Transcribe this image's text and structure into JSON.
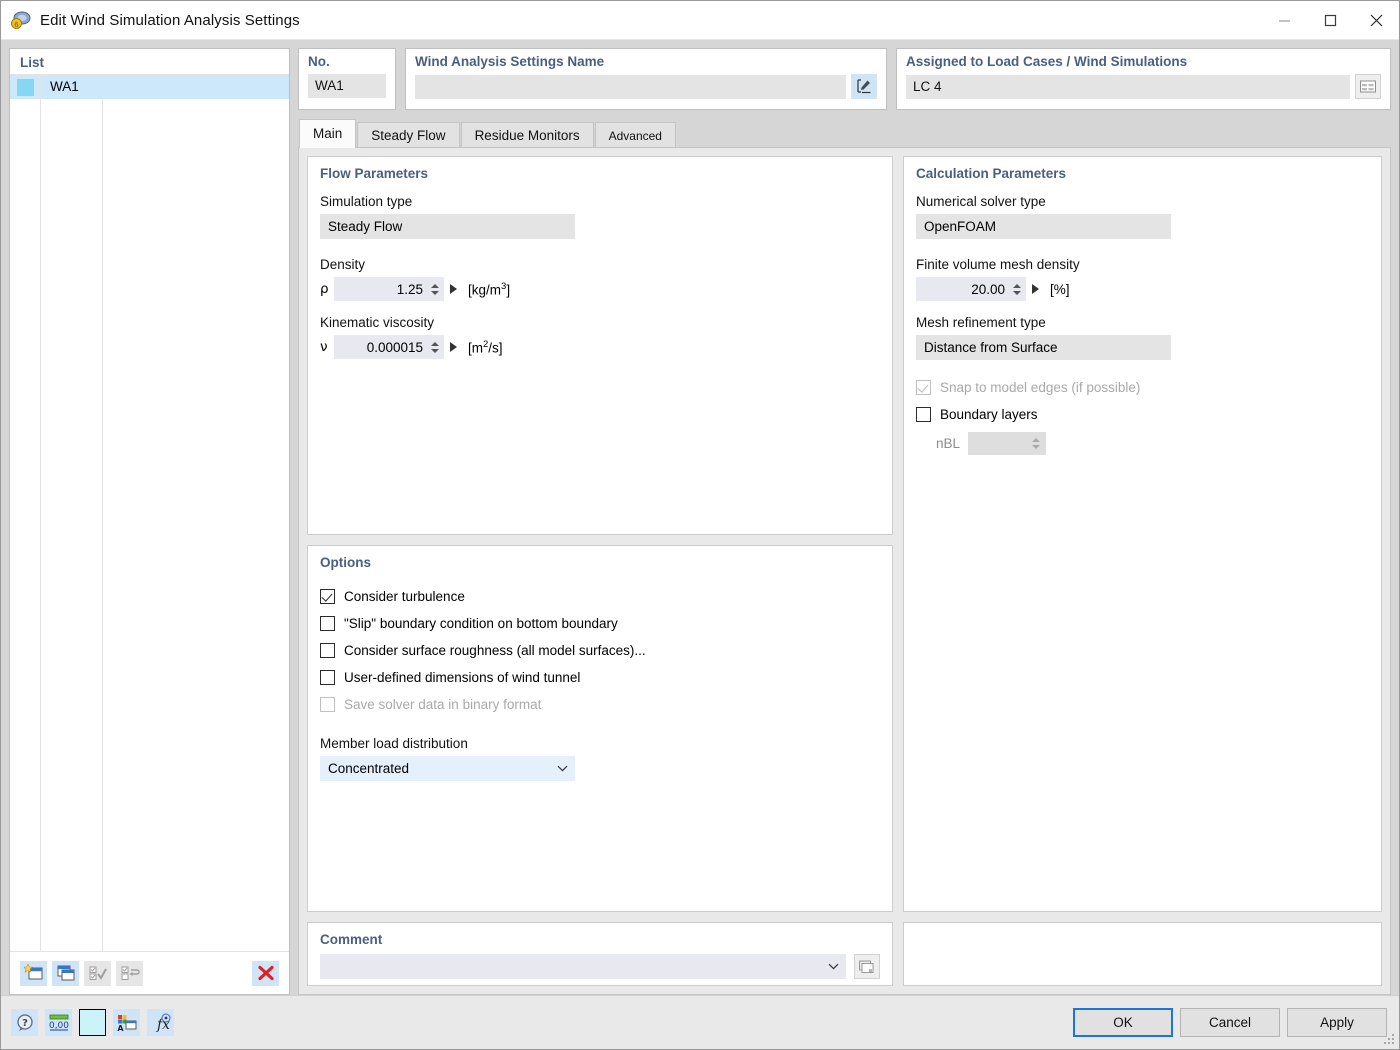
{
  "window": {
    "title": "Edit Wind Simulation Analysis Settings",
    "icon": "wind-simulation-icon",
    "minimize_label": "Minimize",
    "maximize_label": "Maximize",
    "close_label": "Close"
  },
  "list_panel": {
    "caption": "List",
    "rows": [
      {
        "color": "#85d7f2",
        "label": "WA1"
      }
    ],
    "toolbar": [
      {
        "name": "new-settings-button",
        "title": "New",
        "enabled": true
      },
      {
        "name": "copy-settings-button",
        "title": "Copy",
        "enabled": true
      },
      {
        "name": "select-all-button",
        "title": "Select All",
        "enabled": false
      },
      {
        "name": "invert-selection-button",
        "title": "Invert Selection",
        "enabled": false
      },
      {
        "name": "delete-button",
        "title": "Delete",
        "enabled": true
      }
    ]
  },
  "header": {
    "no_label": "No.",
    "no_value": "WA1",
    "name_label": "Wind Analysis Settings Name",
    "name_value": "",
    "name_edit_button": "rename-icon",
    "assigned_label": "Assigned to Load Cases / Wind Simulations",
    "assigned_value": "LC 4",
    "assigned_button": "load-cases-icon"
  },
  "tabs": [
    {
      "label": "Main",
      "active": true
    },
    {
      "label": "Steady Flow",
      "active": false
    },
    {
      "label": "Residue Monitors",
      "active": false
    },
    {
      "label": "Advanced",
      "active": false,
      "small": true
    }
  ],
  "flow_parameters": {
    "title": "Flow Parameters",
    "simulation_type_label": "Simulation type",
    "simulation_type_value": "Steady Flow",
    "density_label": "Density",
    "density_symbol": "ρ",
    "density_value": "1.25",
    "density_unit_prefix": "[kg/m",
    "density_unit_sup": "3",
    "density_unit_suffix": "]",
    "viscosity_label": "Kinematic viscosity",
    "viscosity_symbol": "ν",
    "viscosity_value": "0.000015",
    "viscosity_unit_prefix": "[m",
    "viscosity_unit_sup": "2",
    "viscosity_unit_suffix": "/s]"
  },
  "options": {
    "title": "Options",
    "checkboxes": [
      {
        "label": "Consider turbulence",
        "checked": true,
        "enabled": true
      },
      {
        "label": "\"Slip\" boundary condition on bottom boundary",
        "checked": false,
        "enabled": true
      },
      {
        "label": "Consider surface roughness (all model surfaces)...",
        "checked": false,
        "enabled": true
      },
      {
        "label": "User-defined dimensions of wind tunnel",
        "checked": false,
        "enabled": true
      },
      {
        "label": "Save solver data in binary format",
        "checked": false,
        "enabled": false
      }
    ],
    "member_load_label": "Member load distribution",
    "member_load_value": "Concentrated"
  },
  "calculation_parameters": {
    "title": "Calculation Parameters",
    "solver_label": "Numerical solver type",
    "solver_value": "OpenFOAM",
    "mesh_density_label": "Finite volume mesh density",
    "mesh_density_value": "20.00",
    "mesh_density_unit": "[%]",
    "refinement_label": "Mesh refinement type",
    "refinement_value": "Distance from Surface",
    "checkboxes": [
      {
        "label": "Snap to model edges (if possible)",
        "checked": true,
        "enabled": false
      },
      {
        "label": "Boundary layers",
        "checked": false,
        "enabled": true
      }
    ],
    "nbl_label": "nBL",
    "nbl_value": ""
  },
  "comment": {
    "title": "Comment",
    "value": "",
    "button": "comment-library-icon"
  },
  "footer": {
    "tools": [
      {
        "name": "help-button",
        "title": "Help"
      },
      {
        "name": "units-button",
        "title": "Units"
      },
      {
        "name": "color-button",
        "title": "Color"
      },
      {
        "name": "display-properties-button",
        "title": "Display Properties"
      },
      {
        "name": "formula-button",
        "title": "Formula"
      }
    ],
    "ok": "OK",
    "cancel": "Cancel",
    "apply": "Apply"
  },
  "colors": {
    "accent": "#4a5f80",
    "selection": "#cce8fa",
    "default_button_border": "#1c76d2",
    "delete_red": "#e02020"
  }
}
